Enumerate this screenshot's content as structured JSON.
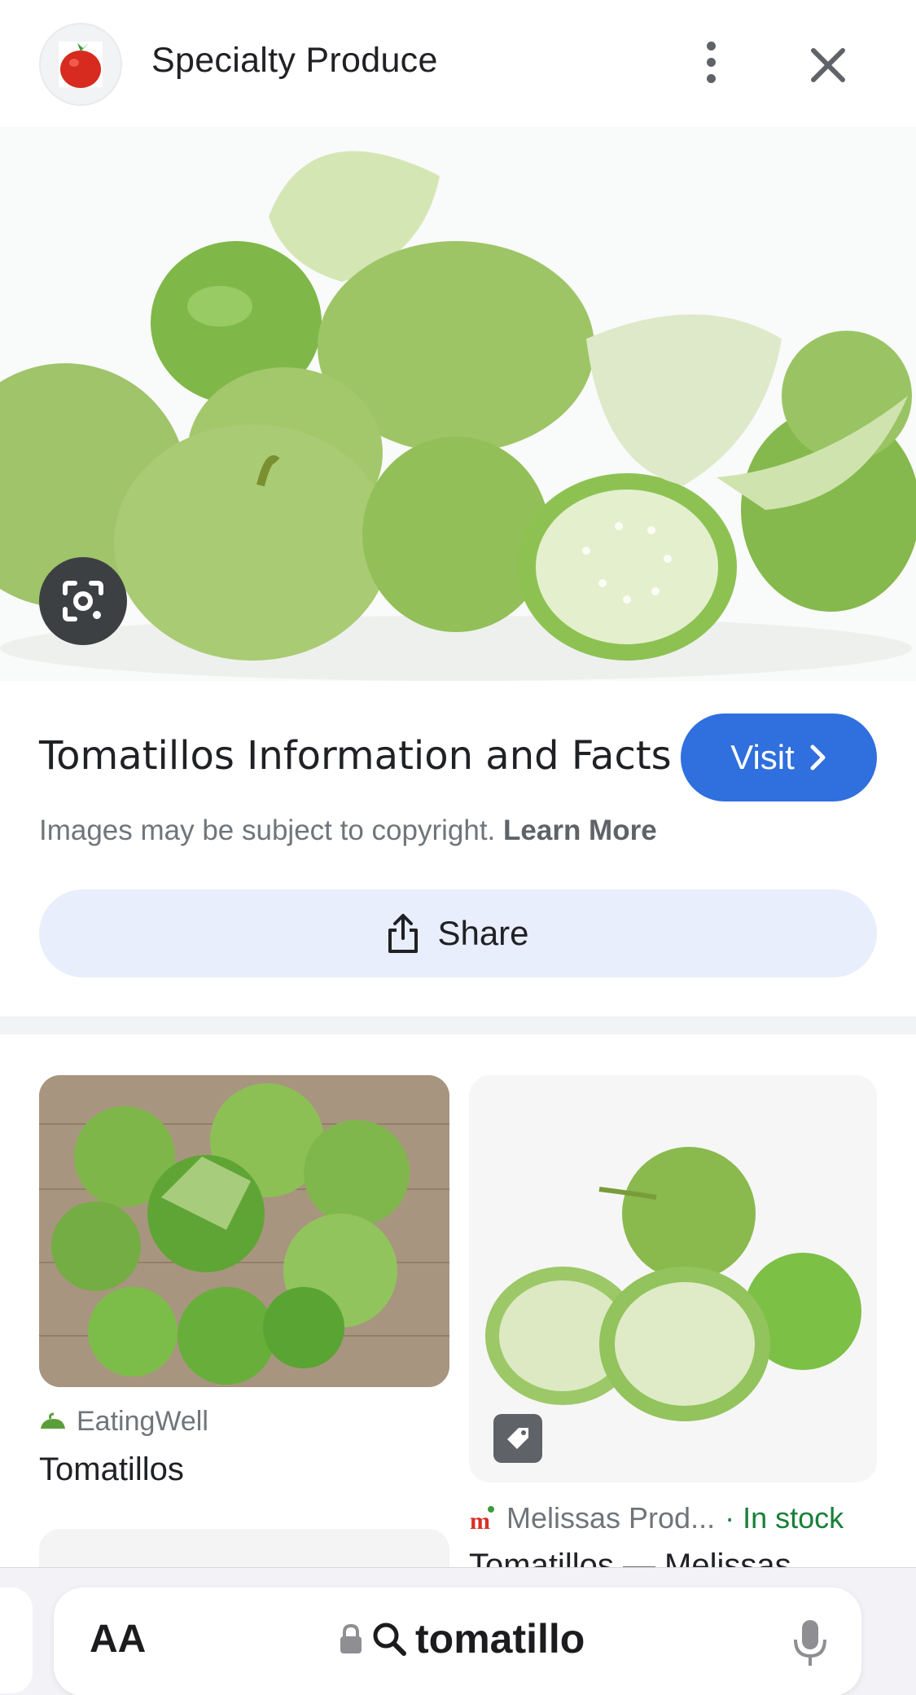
{
  "header": {
    "site_name": "Specialty Produce"
  },
  "result": {
    "title": "Tomatillos Information and Facts",
    "visit_label": "Visit",
    "copyright_text": "Images may be subject to copyright.",
    "learn_more": "Learn More",
    "share_label": "Share"
  },
  "related": [
    {
      "source": "EatingWell",
      "caption": "Tomatillos"
    },
    {
      "source": "Melissas Prod...",
      "stock": "· In stock",
      "caption": "Tomatillos — Melissas"
    }
  ],
  "browser": {
    "text_size_label": "AA",
    "search_query": "tomatillo"
  },
  "colors": {
    "accent": "#2f6fde",
    "share_bg": "#e8eefc",
    "in_stock": "#188038"
  },
  "icons": [
    "tomato-logo-icon",
    "more-vert-icon",
    "close-icon",
    "lens-icon",
    "chevron-right-icon",
    "share-icon",
    "tag-icon",
    "lock-icon",
    "search-icon",
    "mic-icon"
  ]
}
